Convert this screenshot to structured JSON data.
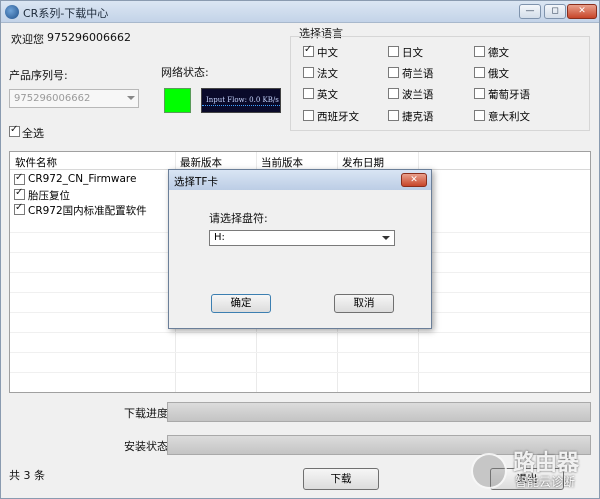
{
  "window": {
    "title": "CR系列-下载中心",
    "minimize_glyph": "—",
    "restore_glyph": "◻",
    "close_glyph": "✕"
  },
  "welcome": {
    "label": "欢迎您",
    "user": "975296006662"
  },
  "serial": {
    "label": "产品序列号:",
    "value": "975296006662"
  },
  "network": {
    "label": "网络状态:",
    "indicator_color": "#00ff00",
    "flow_text": "Input Flow: 0.0 KB/s"
  },
  "select_all": {
    "label": "全选",
    "checked": true
  },
  "languages": {
    "title": "选择语言",
    "items": [
      {
        "label": "中文",
        "checked": true
      },
      {
        "label": "日文",
        "checked": false
      },
      {
        "label": "德文",
        "checked": false
      },
      {
        "label": "法文",
        "checked": false
      },
      {
        "label": "荷兰语",
        "checked": false
      },
      {
        "label": "俄文",
        "checked": false
      },
      {
        "label": "英文",
        "checked": false
      },
      {
        "label": "波兰语",
        "checked": false
      },
      {
        "label": "葡萄牙语",
        "checked": false
      },
      {
        "label": "西班牙文",
        "checked": false
      },
      {
        "label": "捷克语",
        "checked": false
      },
      {
        "label": "意大利文",
        "checked": false
      }
    ]
  },
  "table": {
    "columns": [
      "软件名称",
      "最新版本",
      "当前版本",
      "发布日期"
    ],
    "rows": [
      {
        "name": "CR972_CN_Firmware",
        "checked": true
      },
      {
        "name": "胎压复位",
        "checked": true
      },
      {
        "name": "CR972国内标准配置软件",
        "checked": true
      }
    ]
  },
  "progress": {
    "download_label": "下载进度",
    "install_label": "安装状态"
  },
  "footer": {
    "count": "共 3 条",
    "download_button": "下载",
    "exit_button": "退出"
  },
  "dialog": {
    "title": "选择TF卡",
    "prompt": "请选择盘符:",
    "drive_value": "H:",
    "ok_button": "确定",
    "cancel_button": "取消",
    "close_glyph": "✕"
  },
  "watermark": {
    "big": "路由器",
    "small": "智能云诊断"
  }
}
